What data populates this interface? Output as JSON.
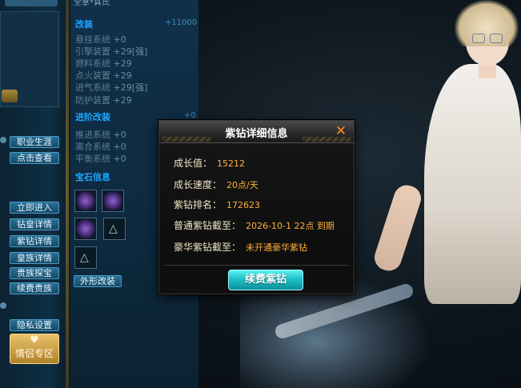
{
  "dialog": {
    "title": "紫钻详细信息",
    "rows": [
      {
        "label": "成长值：",
        "value": "15212"
      },
      {
        "label": "成长速度：",
        "value": "20点/天"
      },
      {
        "label": "紫钻排名：",
        "value": "172623"
      },
      {
        "label": "普通紫钻截至：",
        "value": "2026-10-1 22点 到期"
      },
      {
        "label": "豪华紫钻截至：",
        "value": "未开通豪华紫钻"
      }
    ],
    "renew_label": "续费紫钻",
    "close_icon": "close-icon"
  },
  "left_sidebar": {
    "buttons": [
      {
        "label": "职业生涯"
      },
      {
        "label": "点击查看"
      },
      {
        "label": "立即进入"
      },
      {
        "label": "钻皇详情"
      },
      {
        "label": "紫钻详情"
      },
      {
        "label": "皇族详情"
      },
      {
        "label": "贵族探宝"
      },
      {
        "label": "续费贵族"
      },
      {
        "label": "隐私设置"
      }
    ],
    "romance_label": "情侣专区"
  },
  "attr_panel": {
    "top_cut_text": "全掌*真氏",
    "modify": {
      "title": "改装",
      "total": "+11000",
      "rows": [
        {
          "name": "悬挂系统",
          "value": "+0"
        },
        {
          "name": "引擎装置",
          "value": "+29[强]"
        },
        {
          "name": "燃料系统",
          "value": "+29"
        },
        {
          "name": "点火装置",
          "value": "+29"
        },
        {
          "name": "进气系统",
          "value": "+29[强]"
        },
        {
          "name": "防护装置",
          "value": "+29"
        }
      ]
    },
    "advanced": {
      "title": "进阶改装",
      "total": "+0",
      "rows": [
        {
          "name": "推进系统",
          "value": "+0"
        },
        {
          "name": "离合系统",
          "value": "+0"
        },
        {
          "name": "平衡系统",
          "value": "+0"
        }
      ]
    },
    "gems_title": "宝石信息",
    "appearance_label": "外形改装"
  },
  "colors": {
    "label": "#f1e6c8",
    "value": "#ffb13a",
    "close": "#ff8a1a",
    "renew_button": "#1ec0c8",
    "section_title": "#1fa7ff"
  }
}
